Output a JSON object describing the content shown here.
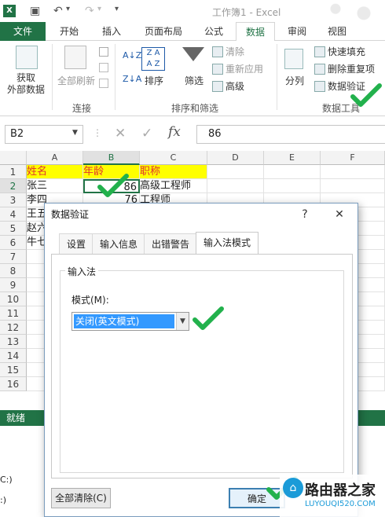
{
  "titlebar": {
    "app_icon": "X",
    "title": "工作簿1 - Excel"
  },
  "tabs": [
    "文件",
    "开始",
    "插入",
    "页面布局",
    "公式",
    "数据",
    "审阅",
    "视图"
  ],
  "ribbon": {
    "get_external": "获取\n外部数据",
    "refresh_all": "全部刷新",
    "group_connections": "连接",
    "sort": "排序",
    "filter": "筛选",
    "clear": "清除",
    "reapply": "重新应用",
    "advanced": "高级",
    "group_sort_filter": "排序和筛选",
    "split": "分列",
    "flash_fill": "快速填充",
    "remove_dup": "删除重复项",
    "data_validation": "数据验证",
    "group_data_tools": "数据工具"
  },
  "formula_bar": {
    "name_box": "B2",
    "cancel": "✕",
    "enter": "✓",
    "fx": "fx",
    "value": "86"
  },
  "grid": {
    "columns": [
      "A",
      "B",
      "C",
      "D",
      "E",
      "F"
    ],
    "rows": [
      "1",
      "2",
      "3",
      "4",
      "5",
      "6",
      "7",
      "8",
      "9",
      "10",
      "11",
      "12",
      "13",
      "14",
      "15",
      "16"
    ],
    "header": [
      "姓名",
      "年龄",
      "职称"
    ],
    "data": [
      [
        "张三",
        "86",
        "高级工程师"
      ],
      [
        "李四",
        "76",
        "工程师"
      ],
      [
        "王五",
        "",
        ""
      ],
      [
        "赵六",
        "",
        ""
      ],
      [
        "牛七",
        "",
        ""
      ]
    ]
  },
  "status": {
    "text": "就绪",
    "below_1": "C:)",
    "below_2": ":)"
  },
  "dialog": {
    "title": "数据验证",
    "help": "?",
    "close": "✕",
    "tabs": [
      "设置",
      "输入信息",
      "出错警告",
      "输入法模式"
    ],
    "active_tab": "输入法模式",
    "group_title": "输入法",
    "mode_label": "模式(M):",
    "mode_value": "关闭(英文模式)",
    "clear_all": "全部清除(C)",
    "ok": "确定"
  },
  "watermark": {
    "title": "路由器之家",
    "url": "LUYOUQI520.COM"
  },
  "colors": {
    "excel_green": "#217346",
    "check_green": "#22b14c",
    "header_yellow": "#ffff00",
    "header_text": "#e03030",
    "selection_blue": "#3399ff"
  }
}
